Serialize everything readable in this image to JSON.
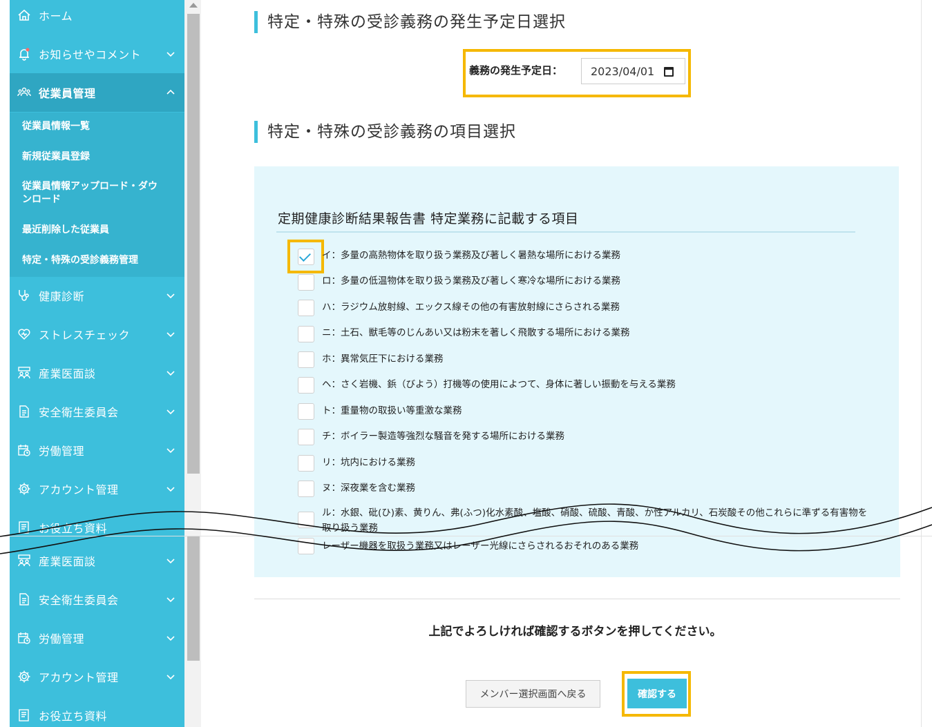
{
  "sidebar": {
    "items": [
      {
        "label": "ホーム",
        "icon": "home-icon"
      },
      {
        "label": "お知らせやコメント",
        "icon": "bell-icon"
      },
      {
        "label": "従業員管理",
        "icon": "people-icon"
      },
      {
        "label": "健康診断",
        "icon": "stethoscope-icon"
      },
      {
        "label": "ストレスチェック",
        "icon": "heart-icon"
      },
      {
        "label": "産業医面談",
        "icon": "meeting-icon"
      },
      {
        "label": "安全衛生委員会",
        "icon": "document-icon"
      },
      {
        "label": "労働管理",
        "icon": "calendar-clock-icon"
      },
      {
        "label": "アカウント管理",
        "icon": "gear-icon"
      },
      {
        "label": "お役立ち資料",
        "icon": "book-icon"
      }
    ],
    "sub_items": [
      "従業員情報一覧",
      "新規従業員登録",
      "従業員情報アップロード・ダウンロード",
      "最近削除した従業員",
      "特定・特殊の受診義務管理"
    ],
    "bottom_items": [
      {
        "label": "産業医面談",
        "icon": "meeting-icon"
      },
      {
        "label": "安全衛生委員会",
        "icon": "document-icon"
      },
      {
        "label": "労働管理",
        "icon": "calendar-clock-icon"
      },
      {
        "label": "アカウント管理",
        "icon": "gear-icon"
      },
      {
        "label": "お役立ち資料",
        "icon": "book-icon"
      }
    ],
    "bg_color": "#3dbfdc"
  },
  "main": {
    "section1_title": "特定・特殊の受診義務の発生予定日選択",
    "date_label": "義務の発生予定日：",
    "date_value": "2023/04/01",
    "section2_title": "特定・特殊の受診義務の項目選択",
    "panel_title": "定期健康診断結果報告書 特定業務に記載する項目",
    "items": [
      {
        "text": "イ：多量の高熱物体を取り扱う業務及び著しく暑熱な場所における業務",
        "checked": true
      },
      {
        "text": "ロ：多量の低温物体を取り扱う業務及び著しく寒冷な場所における業務",
        "checked": false
      },
      {
        "text": "ハ：ラジウム放射線、エックス線その他の有害放射線にさらされる業務",
        "checked": false
      },
      {
        "text": "ニ：土石、獣毛等のじんあい又は粉末を著しく飛散する場所における業務",
        "checked": false
      },
      {
        "text": "ホ：異常気圧下における業務",
        "checked": false
      },
      {
        "text": "ヘ：さく岩機、鋲（びよう）打機等の使用によつて、身体に著しい振動を与える業務",
        "checked": false
      },
      {
        "text": "ト：重量物の取扱い等重激な業務",
        "checked": false
      },
      {
        "text": "チ：ボイラー製造等強烈な騒音を発する場所における業務",
        "checked": false
      },
      {
        "text": "リ：坑内における業務",
        "checked": false
      },
      {
        "text": "ヌ：深夜業を含む業務",
        "checked": false
      },
      {
        "text": "ル：水銀、砒(ひ)素、黄りん、弗(ふつ)化水素酸、塩酸、硝酸、硫酸、青酸、か性アルカリ、石炭酸その他これらに準ずる有害物を取り扱う業務",
        "checked": false
      },
      {
        "text": "レーザー機器を取扱う業務又はレーザー光線にさらされるおそれのある業務",
        "checked": false
      }
    ],
    "confirm_message": "上記でよろしければ確認するボタンを押してください。",
    "back_button": "メンバー選択画面へ戻る",
    "confirm_button": "確認する",
    "highlight_color": "#f5b800"
  }
}
